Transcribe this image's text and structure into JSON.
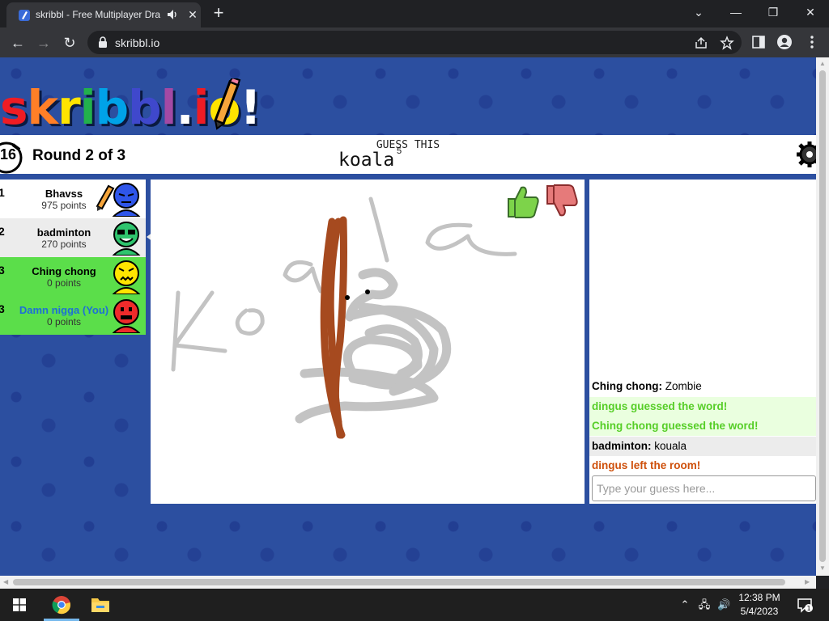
{
  "browser": {
    "tab_title": "skribbl - Free Multiplayer Dra",
    "new_tab_label": "+",
    "url": "skribbl.io"
  },
  "game": {
    "logo_letters": [
      "s",
      "k",
      "r",
      "i",
      "b",
      "b",
      "l",
      ".",
      "i",
      "o",
      "!"
    ],
    "logo_colors": [
      "#ef1c24",
      "#ff7f27",
      "#ffe400",
      "#22b14c",
      "#00a2e8",
      "#3f48cc",
      "#a349a4",
      "#ffffff",
      "#ef1c24",
      "#ffe400",
      "#ffffff"
    ],
    "timer": "16",
    "round_label": "Round 2 of 3",
    "hint_label": "GUESS THIS",
    "word": "koala",
    "word_length": "5"
  },
  "players": [
    {
      "rank": "1",
      "name": "Bhavss",
      "points": "975 points",
      "avatar_color": "#2f56ea",
      "bg": "#ffffff",
      "name_color": "#000000",
      "drawing": true
    },
    {
      "rank": "2",
      "name": "badminton",
      "points": "270 points",
      "avatar_color": "#2fc46e",
      "bg": "#ececec",
      "name_color": "#000000",
      "drawing": false
    },
    {
      "rank": "3",
      "name": "Ching chong",
      "points": "0 points",
      "avatar_color": "#ffe400",
      "bg": "#5bde4a",
      "name_color": "#000000",
      "drawing": false
    },
    {
      "rank": "3",
      "name": "Damn nigga (You)",
      "points": "0 points",
      "avatar_color": "#ef2b2b",
      "bg": "#5bde4a",
      "name_color": "#1e6fd6",
      "drawing": false
    }
  ],
  "speech_bubble": "kouala",
  "chat": {
    "messages": [
      {
        "sender": "Ching chong:",
        "text": "Zombie",
        "style": "plain"
      },
      {
        "sender": "",
        "text": "dingus guessed the word!",
        "style": "green"
      },
      {
        "sender": "",
        "text": "Ching chong guessed the word!",
        "style": "green"
      },
      {
        "sender": "badminton:",
        "text": "kouala",
        "style": "gray"
      },
      {
        "sender": "",
        "text": "dingus left the room!",
        "style": "red"
      }
    ],
    "input_placeholder": "Type your guess here..."
  },
  "taskbar": {
    "time": "12:38 PM",
    "date": "5/4/2023",
    "notification_count": "1"
  },
  "colors": {
    "page_bg": "#2c4fa0",
    "green_highlight": "#5bde4a",
    "guessed_text": "#56ce27",
    "left_text": "#ce4f0a"
  }
}
